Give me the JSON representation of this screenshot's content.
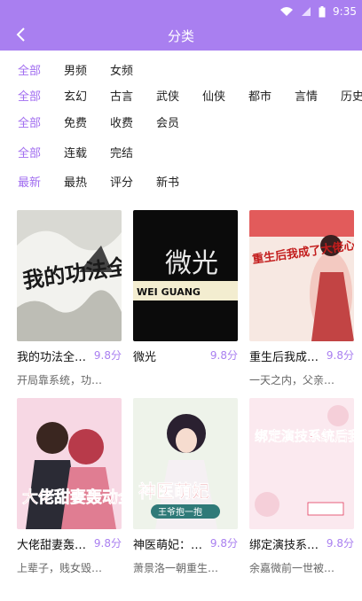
{
  "status": {
    "time": "9:35"
  },
  "header": {
    "title": "分类"
  },
  "filters": [
    [
      "全部",
      "男频",
      "女频"
    ],
    [
      "全部",
      "玄幻",
      "古言",
      "武侠",
      "仙侠",
      "都市",
      "言情",
      "历史"
    ],
    [
      "全部",
      "免费",
      "收费",
      "会员"
    ],
    [
      "全部",
      "连载",
      "完结"
    ],
    [
      "最新",
      "最热",
      "评分",
      "新书"
    ]
  ],
  "books": [
    {
      "name": "我的功法全…",
      "score": "9.8分",
      "desc": "开局靠系统，功…",
      "cover_text": "我的功法全靠偷"
    },
    {
      "name": "微光",
      "score": "9.8分",
      "desc": "",
      "cover_text": "微光",
      "cover_sub": "WEI GUANG"
    },
    {
      "name": "重生后我成…",
      "score": "9.8分",
      "desc": "一天之内，父亲…",
      "cover_text": "重生后我成了大佬心尖尖"
    },
    {
      "name": "大佬甜妻轰…",
      "score": "9.8分",
      "desc": "上辈子，贱女毁…",
      "cover_text": "大佬甜妻轰动全城"
    },
    {
      "name": "神医萌妃：…",
      "score": "9.8分",
      "desc": "萧景洛一朝重生…",
      "cover_text": "神医萌妃",
      "cover_sub": "王爷抱一抱"
    },
    {
      "name": "绑定演技系…",
      "score": "9.8分",
      "desc": "余嘉微前一世被…",
      "cover_text": "绑定演技系统后我爆红了"
    }
  ],
  "colors": {
    "accent": "#a97ff0",
    "selected": "#a26ef0"
  }
}
